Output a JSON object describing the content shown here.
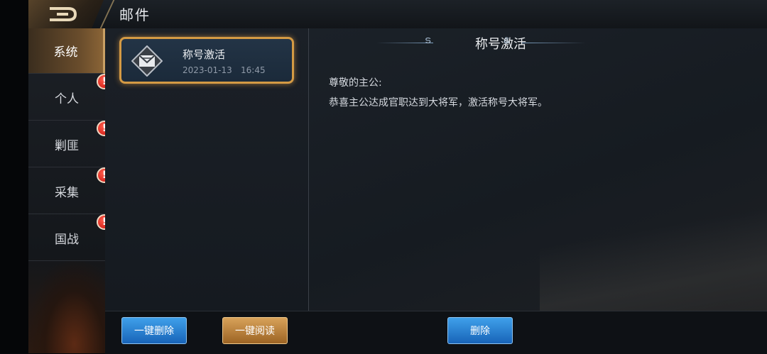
{
  "header": {
    "title": "邮件"
  },
  "sidebar": {
    "items": [
      {
        "label": "系统",
        "active": true,
        "badge": ""
      },
      {
        "label": "个人",
        "active": false,
        "badge": "!"
      },
      {
        "label": "剿匪",
        "active": false,
        "badge": "!"
      },
      {
        "label": "采集",
        "active": false,
        "badge": "!"
      },
      {
        "label": "国战",
        "active": false,
        "badge": "!"
      }
    ]
  },
  "mail_list": [
    {
      "title": "称号激活",
      "date": "2023-01-13",
      "time": "16:45",
      "icon": "envelope-icon"
    }
  ],
  "detail": {
    "title": "称号激活",
    "greeting": "尊敬的主公:",
    "body": "恭喜主公达成官职达到大将军，激活称号大将军。"
  },
  "buttons": {
    "delete_all": "一键删除",
    "read_all": "一键阅读",
    "delete": "删除"
  },
  "colors": {
    "accent_gold": "#d49a44",
    "button_blue": "#1864b8",
    "badge_red": "#c8140e"
  }
}
